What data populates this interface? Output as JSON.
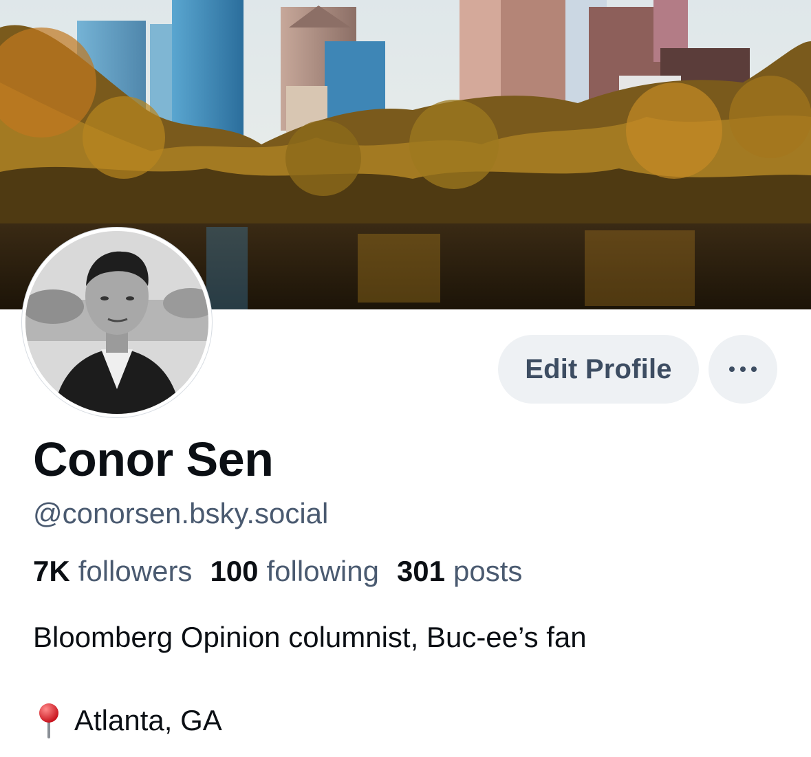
{
  "profile": {
    "display_name": "Conor Sen",
    "handle": "@conorsen.bsky.social",
    "bio": "Bloomberg Opinion columnist, Buc-ee’s fan",
    "location_icon": "round-pushpin-icon",
    "location": "Atlanta, GA"
  },
  "stats": {
    "followers_count": "7K",
    "followers_label": "followers",
    "following_count": "100",
    "following_label": "following",
    "posts_count": "301",
    "posts_label": "posts"
  },
  "actions": {
    "edit_profile_label": "Edit Profile",
    "more_icon": "ellipsis-icon"
  },
  "colors": {
    "button_bg": "#eef1f4",
    "button_text": "#3d4d62",
    "muted_text": "#4a5a70",
    "primary_text": "#0b0f14"
  }
}
